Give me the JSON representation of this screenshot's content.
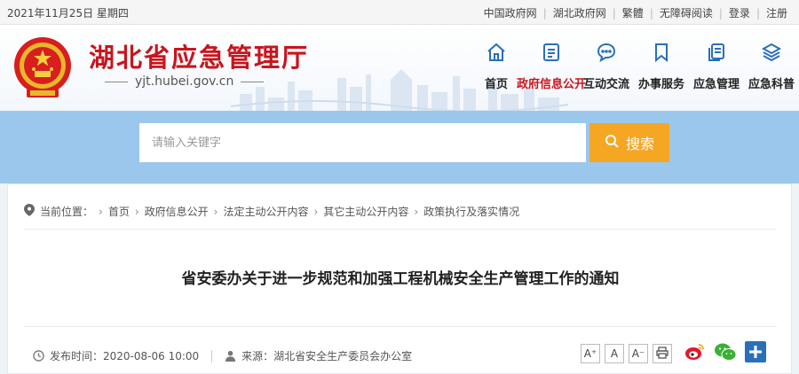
{
  "topbar": {
    "date": "2021年11月25日 星期四",
    "links": [
      "中国政府网",
      "湖北政府网",
      "繁體",
      "无障碍阅读",
      "登录",
      "注册"
    ]
  },
  "header": {
    "title": "湖北省应急管理厅",
    "domain": "yjt.hubei.gov.cn",
    "nav": [
      {
        "label": "首页",
        "icon": "home-icon"
      },
      {
        "label": "政府信息公开",
        "icon": "document-icon",
        "active": true
      },
      {
        "label": "互动交流",
        "icon": "chat-icon"
      },
      {
        "label": "办事服务",
        "icon": "bookmark-icon"
      },
      {
        "label": "应急管理",
        "icon": "clipboard-icon"
      },
      {
        "label": "应急科普",
        "icon": "layers-icon"
      }
    ]
  },
  "search": {
    "placeholder": "请输入关键字",
    "button_label": "搜索"
  },
  "breadcrumb": {
    "prefix": "当前位置：",
    "items": [
      "首页",
      "政府信息公开",
      "法定主动公开内容",
      "其它主动公开内容",
      "政策执行及落实情况"
    ]
  },
  "article": {
    "title": "省安委办关于进一步规范和加强工程机械安全生产管理工作的通知",
    "publish_label": "发布时间：",
    "publish_time": "2020-08-06 10:00",
    "source_label": "来源：",
    "source": "湖北省安全生产委员会办公室"
  },
  "font_tools": [
    "A⁺",
    "A",
    "A⁻"
  ],
  "colors": {
    "brand_red": "#c8151d",
    "search_orange": "#f5a623",
    "band_blue": "#9cc7ec",
    "nav_icon_blue": "#2a6fb8"
  }
}
